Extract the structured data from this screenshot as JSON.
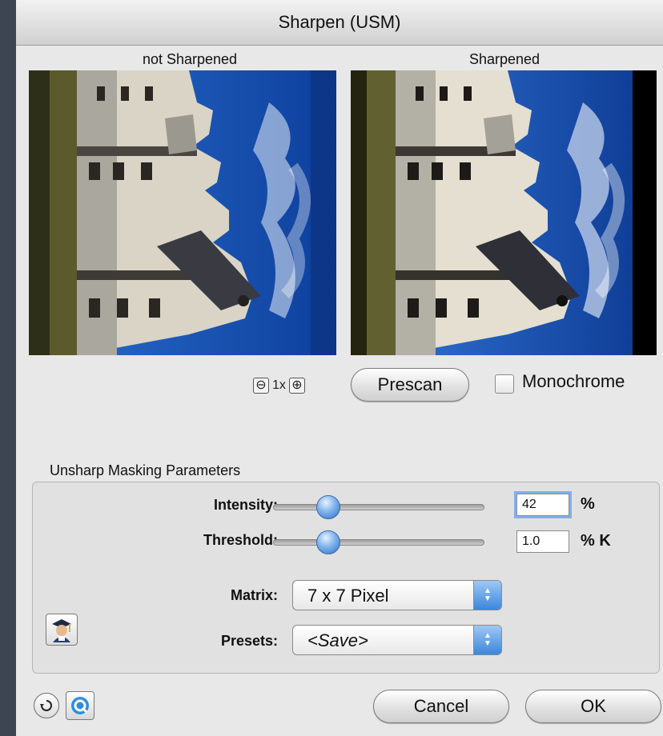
{
  "window": {
    "title": "Sharpen (USM)"
  },
  "previews": {
    "left_caption": "not Sharpened",
    "right_caption": "Sharpened"
  },
  "zoom": {
    "minus_icon": "zoom-out-icon",
    "level": "1x",
    "plus_icon": "zoom-in-icon"
  },
  "prescan_label": "Prescan",
  "monochrome": {
    "label": "Monochrome",
    "checked": false
  },
  "usm": {
    "group_title": "Unsharp Masking Parameters",
    "intensity": {
      "label": "Intensity:",
      "value": "42",
      "unit": "%",
      "slider_fraction": 0.26
    },
    "threshold": {
      "label": "Threshold:",
      "value": "1.0",
      "unit": "% K",
      "slider_fraction": 0.26
    },
    "matrix": {
      "label": "Matrix:",
      "selected": "7 x 7 Pixel"
    },
    "presets": {
      "label": "Presets:",
      "selected": "<Save>"
    }
  },
  "buttons": {
    "cancel": "Cancel",
    "ok": "OK"
  },
  "icons": {
    "professor": "professor-avatar-icon",
    "reset": "reset-icon",
    "help": "quickhelp-icon"
  },
  "colors": {
    "accent": "#3d86dc",
    "sky": "#1f5fbf",
    "background": "#3d4452"
  }
}
